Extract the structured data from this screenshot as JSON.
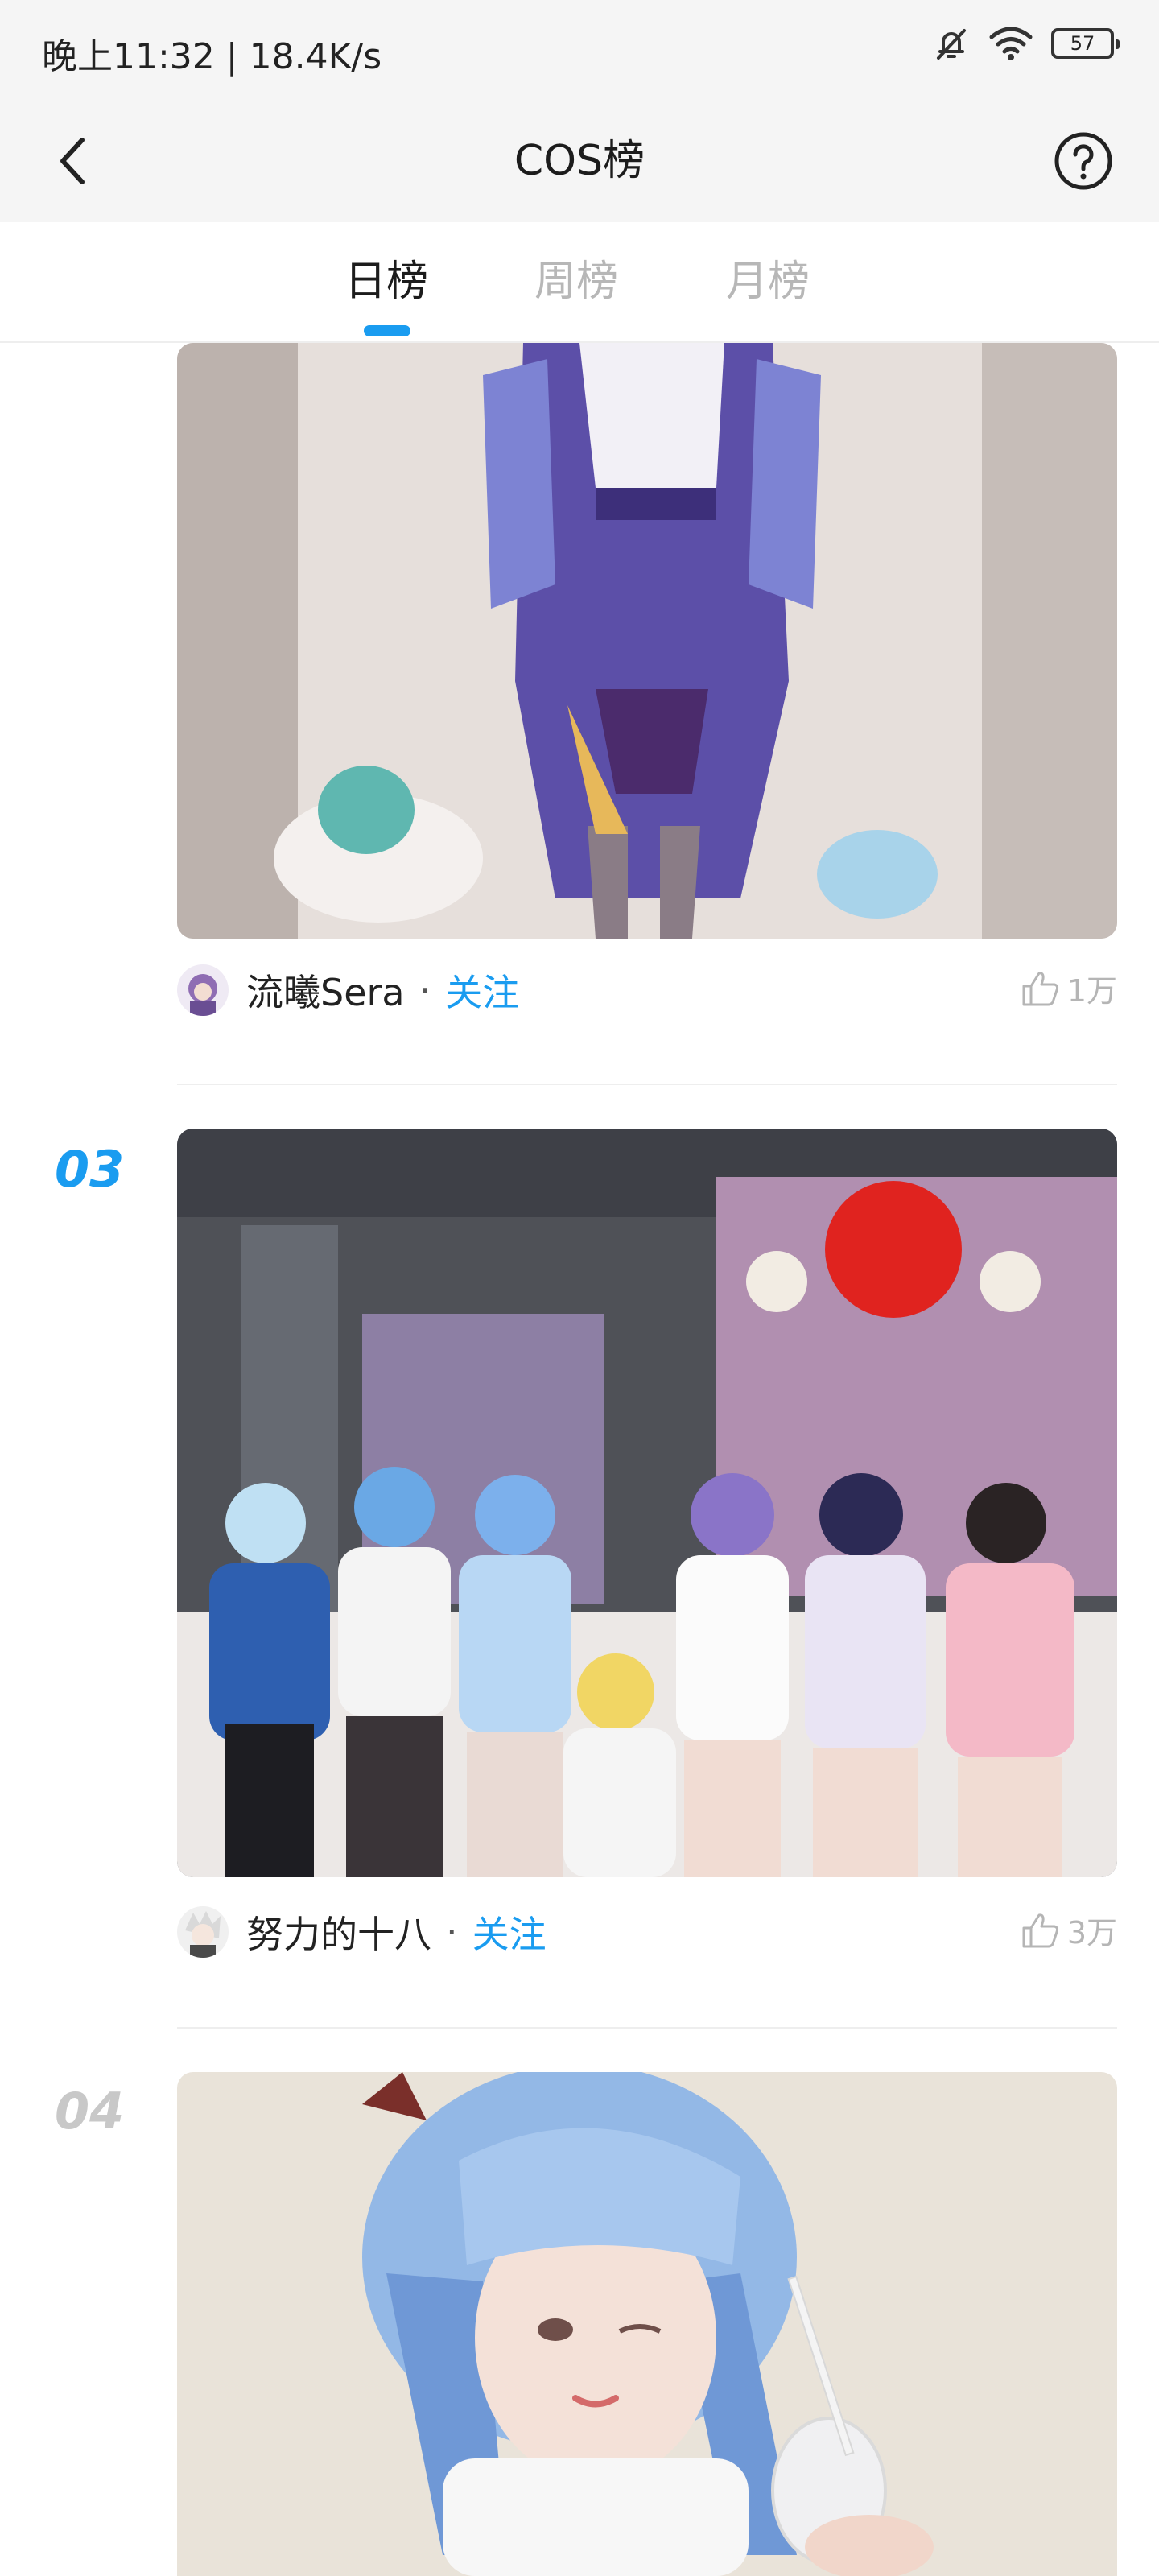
{
  "status_bar": {
    "time_speed": "晚上11:32 | 18.4K/s",
    "battery": "57"
  },
  "header": {
    "title": "COS榜"
  },
  "tabs": [
    {
      "label": "日榜",
      "active": true
    },
    {
      "label": "周榜",
      "active": false
    },
    {
      "label": "月榜",
      "active": false
    }
  ],
  "posts": [
    {
      "author": "流曦Sera",
      "separator": "·",
      "follow": "关注",
      "likes": "1万"
    },
    {
      "rank": "03",
      "author": "努力的十八",
      "separator": "·",
      "follow": "关注",
      "likes": "3万"
    },
    {
      "rank": "04"
    }
  ],
  "colors": {
    "accent": "#1a9cf0",
    "rank_inactive": "#c8c8c8"
  }
}
